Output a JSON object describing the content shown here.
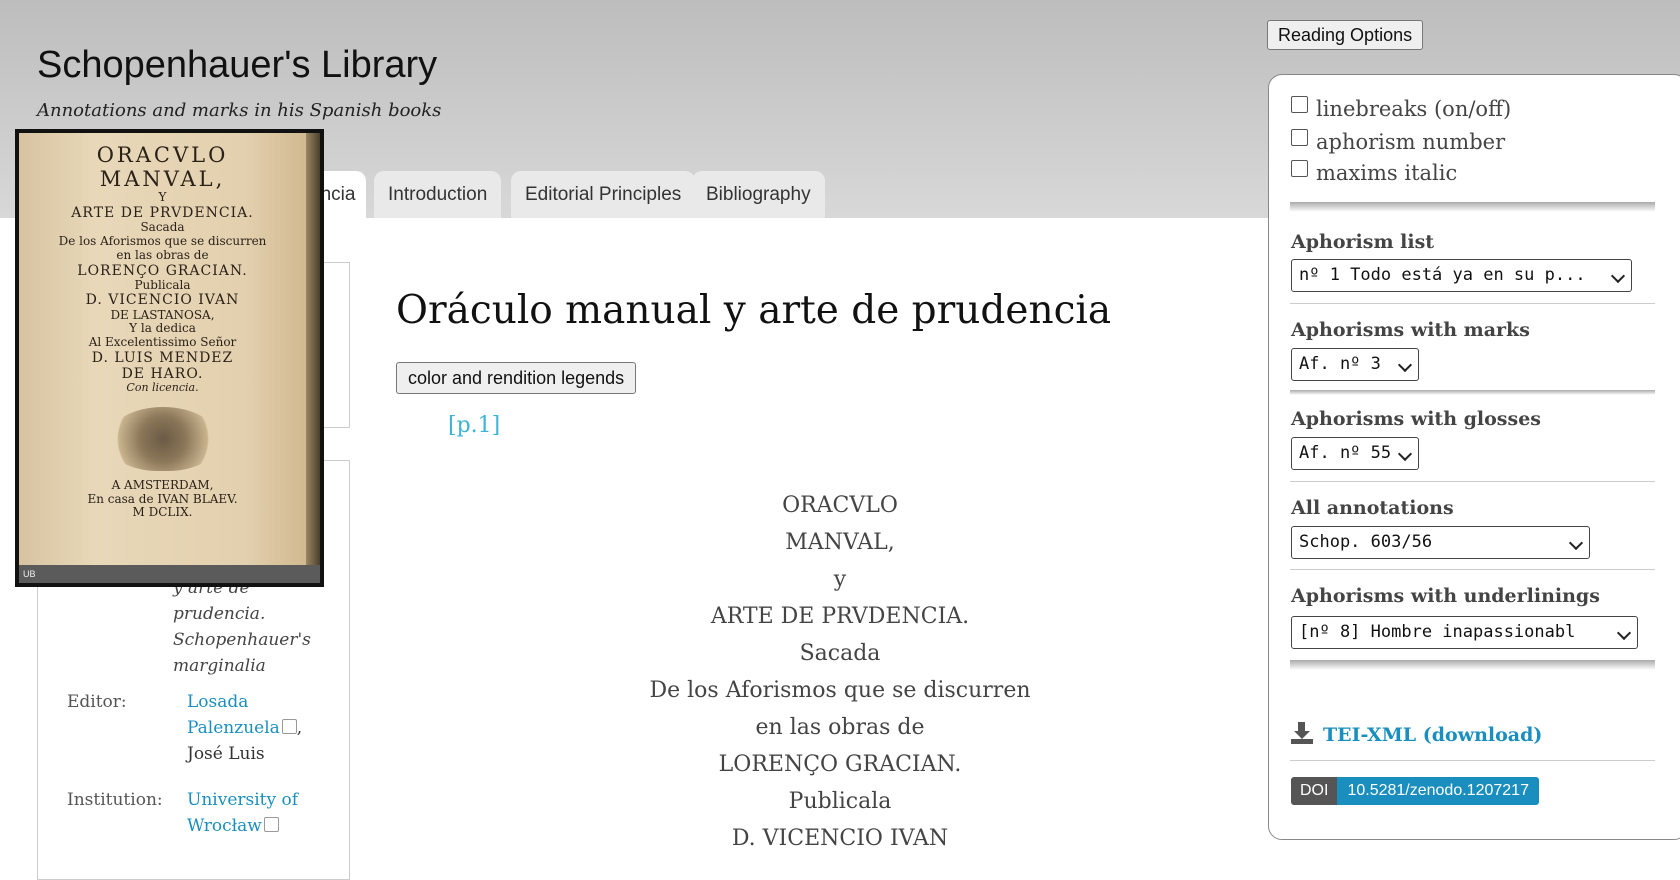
{
  "header": {
    "site_title": "Schopenhauer's Library",
    "subtitle": "Annotations and marks in his Spanish books"
  },
  "tabs": [
    {
      "label": "encia"
    },
    {
      "label": "Introduction"
    },
    {
      "label": "Editorial Principles"
    },
    {
      "label": "Bibliography"
    }
  ],
  "thumbnail": {
    "lines": [
      "ORACVLO",
      "MANVAL,",
      "Y",
      "ARTE DE PRVDENCIA.",
      "Sacada",
      "De los Aforismos que se discurren",
      "en las obras de",
      "LORENÇO GRACIAN.",
      "Publicala",
      "D. VICENCIO IVAN",
      "DE LASTANOSA,",
      "Y la dedica",
      "Al Excelentissimo Señor",
      "D. LUIS MENDEZ",
      "DE HARO.",
      "Con licencia.",
      "A AMSTERDAM,",
      "En casa de IVAN BLAEV.",
      "M DCLIX."
    ],
    "footer": "UB"
  },
  "metadata": {
    "title_tail": [
      "y arte de",
      "prudencia.",
      "Schopenhauer's",
      "marginalia"
    ],
    "editor_label": "Editor:",
    "editor_link_line1": "Losada",
    "editor_link_line2": "Palenzuela",
    "editor_rest": "José Luis",
    "institution_label": "Institution:",
    "institution_line1": "University of",
    "institution_line2": "Wrocław"
  },
  "main": {
    "title": "Oráculo manual y arte de prudencia",
    "legend_button": "color and rendition legends",
    "page_ref": "[p.1]",
    "transcription": [
      "ORACVLO",
      "MANVAL,",
      "y",
      "ARTE DE PRVDENCIA.",
      "Sacada",
      "De los Aforismos que se discurren",
      "en las obras de",
      "LORENÇO GRACIAN.",
      "Publicala",
      "D. VICENCIO IVAN"
    ]
  },
  "sidebar": {
    "reading_options_button": "Reading Options",
    "checkboxes": [
      {
        "label": "linebreaks (on/off)",
        "checked": false
      },
      {
        "label": "aphorism number",
        "checked": false
      },
      {
        "label": "maxims italic",
        "checked": false
      }
    ],
    "aphorism_list_label": "Aphorism list",
    "aphorism_list_value": "nº 1  Todo está ya en su p...",
    "marks_label": "Aphorisms with marks",
    "marks_value": "Af. nº 3",
    "glosses_label": "Aphorisms with glosses",
    "glosses_value": "Af. nº 55",
    "annotations_label": "All annotations",
    "annotations_value": "Schop. 603/56",
    "underlinings_label": "Aphorisms with underlinings",
    "underlinings_value": "[nº 8]  Hombre inapassionabl",
    "tei_link": "TEI-XML (download)",
    "doi_label": "DOI",
    "doi_value": "10.5281/zenodo.1207217"
  },
  "colors": {
    "link": "#1a8fbf",
    "page_ref": "#3bb3d6",
    "header_bg": "#c9c9c9"
  }
}
